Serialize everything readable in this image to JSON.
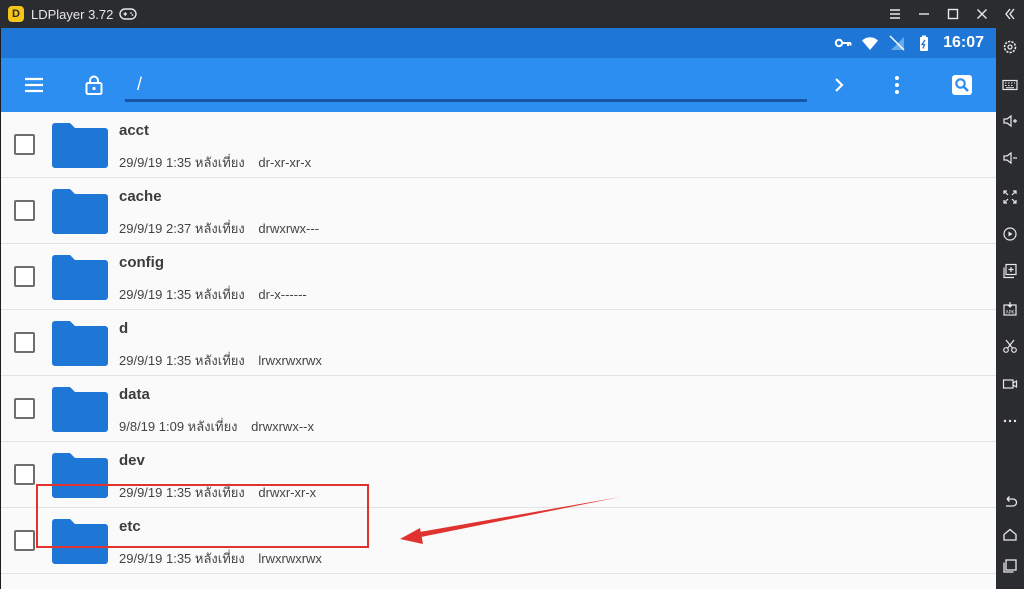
{
  "window": {
    "title": "LDPlayer 3.72",
    "controls": [
      "menu-icon",
      "minimize-icon",
      "maximize-icon",
      "close-icon"
    ]
  },
  "sidebar": {
    "items": [
      "collapse-icon",
      "settings-icon",
      "keyboard-icon",
      "volume-up-icon",
      "volume-down-icon",
      "fullscreen-icon",
      "record-icon",
      "multi-instance-icon",
      "apk-icon",
      "cut-icon",
      "video-icon",
      "more-icon",
      "back-icon",
      "home-icon",
      "recent-apps-icon"
    ]
  },
  "status_bar": {
    "time": "16:07",
    "icons": [
      "key-icon",
      "wifi-icon",
      "no-signal-icon",
      "battery-icon"
    ]
  },
  "toolbar": {
    "path": "/"
  },
  "files": [
    {
      "name": "acct",
      "date": "29/9/19 1:35 หลังเที่ยง",
      "perm": "dr-xr-xr-x"
    },
    {
      "name": "cache",
      "date": "29/9/19 2:37 หลังเที่ยง",
      "perm": "drwxrwx---"
    },
    {
      "name": "config",
      "date": "29/9/19 1:35 หลังเที่ยง",
      "perm": "dr-x------"
    },
    {
      "name": "d",
      "date": "29/9/19 1:35 หลังเที่ยง",
      "perm": "lrwxrwxrwx"
    },
    {
      "name": "data",
      "date": "9/8/19 1:09 หลังเที่ยง",
      "perm": "drwxrwx--x"
    },
    {
      "name": "dev",
      "date": "29/9/19 1:35 หลังเที่ยง",
      "perm": "drwxr-xr-x"
    },
    {
      "name": "etc",
      "date": "29/9/19 1:35 หลังเที่ยง",
      "perm": "lrwxrwxrwx"
    }
  ],
  "colors": {
    "status_bar": "#1e76d6",
    "toolbar": "#2b8ef0",
    "folder": "#1e76d6",
    "annotation": "#e0322f"
  }
}
